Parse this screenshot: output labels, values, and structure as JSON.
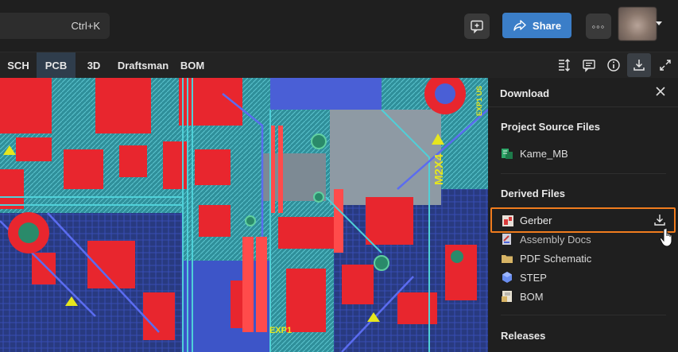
{
  "topbar": {
    "search": {
      "shortcut": "Ctrl+K"
    },
    "share_label": "Share",
    "more_label": "◦◦◦"
  },
  "toolbar": {
    "tabs": [
      {
        "label": "SCH",
        "active": false
      },
      {
        "label": "PCB",
        "active": true
      },
      {
        "label": "3D",
        "active": false
      },
      {
        "label": "Draftsman",
        "active": false
      },
      {
        "label": "BOM",
        "active": false
      }
    ],
    "icons": [
      "layer-height-icon",
      "comments-icon",
      "info-icon",
      "download-icon",
      "expand-icon"
    ],
    "active_icon": "download-icon"
  },
  "pcb": {
    "labels": [
      "EXP1",
      "M2X4",
      "EXP1 US"
    ]
  },
  "panel": {
    "title": "Download",
    "sections": [
      {
        "title": "Project Source Files",
        "items": [
          {
            "label": "Kame_MB",
            "icon": "project-file-icon"
          }
        ]
      },
      {
        "title": "Derived Files",
        "items": [
          {
            "label": "Gerber",
            "icon": "gerber-file-icon",
            "highlighted": true,
            "action": "download-icon"
          },
          {
            "label": "Assembly Docs",
            "icon": "assembly-docs-icon"
          },
          {
            "label": "PDF Schematic",
            "icon": "folder-icon"
          },
          {
            "label": "STEP",
            "icon": "step-cube-icon"
          },
          {
            "label": "BOM",
            "icon": "bom-file-icon"
          }
        ]
      },
      {
        "title": "Releases",
        "items": []
      }
    ]
  },
  "colors": {
    "accent": "#3b7ec8",
    "highlight": "#f07c1e",
    "panel_bg": "#1f1f1f",
    "pcb_red": "#e8262e",
    "pcb_blue": "#4a63d8",
    "pcb_cyan": "#46c8d2",
    "pcb_yellow": "#e6e61e"
  }
}
